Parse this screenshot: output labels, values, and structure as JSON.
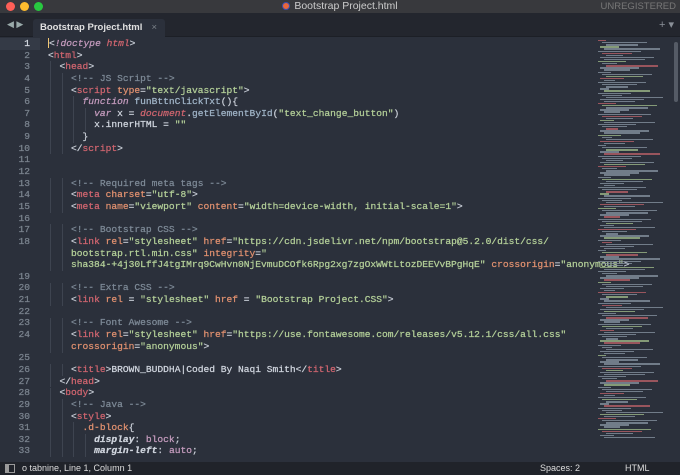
{
  "window": {
    "title": "Bootstrap Project.html",
    "unregistered": "UNREGISTERED"
  },
  "tabs": [
    {
      "label": "Bootstrap Project.html",
      "close": "×"
    }
  ],
  "tabbar": {
    "nav": "◀ ▶",
    "actions": "+ ▾"
  },
  "status": {
    "left": "o tabnine, Line 1, Column 1",
    "spaces": "Spaces: 2",
    "syntax": "HTML"
  },
  "colors": {
    "background": "#2b303b",
    "tag": "#bf616a",
    "attr": "#d08770",
    "string": "#a3be8c",
    "comment": "#65737e"
  },
  "lines": [
    {
      "n": "1",
      "i": 0,
      "rows": [
        [
          [
            "punct",
            "<"
          ],
          [
            "kw",
            "!doctype"
          ],
          [
            "plain",
            " "
          ],
          [
            "var",
            "html"
          ],
          [
            "punct",
            ">"
          ]
        ]
      ]
    },
    {
      "n": "2",
      "i": 0,
      "rows": [
        [
          [
            "punct",
            "<"
          ],
          [
            "tag",
            "html"
          ],
          [
            "punct",
            ">"
          ]
        ]
      ]
    },
    {
      "n": "3",
      "i": 2,
      "rows": [
        [
          [
            "punct",
            "<"
          ],
          [
            "tag",
            "head"
          ],
          [
            "punct",
            ">"
          ]
        ]
      ]
    },
    {
      "n": "4",
      "i": 4,
      "rows": [
        [
          [
            "com",
            "<!-- JS Script -->"
          ]
        ]
      ]
    },
    {
      "n": "5",
      "i": 4,
      "rows": [
        [
          [
            "punct",
            "<"
          ],
          [
            "tag",
            "script"
          ],
          [
            "plain",
            " "
          ],
          [
            "attr",
            "type"
          ],
          [
            "punct",
            "="
          ],
          [
            "str",
            "\"text/javascript\""
          ],
          [
            "punct",
            ">"
          ]
        ]
      ]
    },
    {
      "n": "6",
      "i": 6,
      "rows": [
        [
          [
            "kw",
            "function"
          ],
          [
            "plain",
            " "
          ],
          [
            "fn",
            "funBttnClickTxt"
          ],
          [
            "punct",
            "(){"
          ]
        ]
      ]
    },
    {
      "n": "7",
      "i": 8,
      "rows": [
        [
          [
            "kw",
            "var"
          ],
          [
            "plain",
            " x = "
          ],
          [
            "var",
            "document"
          ],
          [
            "plain",
            "."
          ],
          [
            "fn",
            "getElementById"
          ],
          [
            "punct",
            "("
          ],
          [
            "str",
            "\"text_change_button\""
          ],
          [
            "punct",
            ")"
          ]
        ]
      ]
    },
    {
      "n": "8",
      "i": 8,
      "rows": [
        [
          [
            "plain",
            "x.innerHTML = "
          ],
          [
            "str",
            "\"\""
          ]
        ]
      ]
    },
    {
      "n": "9",
      "i": 6,
      "rows": [
        [
          [
            "punct",
            "}"
          ]
        ]
      ]
    },
    {
      "n": "10",
      "i": 4,
      "rows": [
        [
          [
            "punct",
            "</"
          ],
          [
            "tag",
            "script"
          ],
          [
            "punct",
            ">"
          ]
        ]
      ]
    },
    {
      "n": "11",
      "i": 0,
      "rows": [
        []
      ]
    },
    {
      "n": "12",
      "i": 0,
      "rows": [
        []
      ]
    },
    {
      "n": "13",
      "i": 4,
      "rows": [
        [
          [
            "com",
            "<!-- Required meta tags -->"
          ]
        ]
      ]
    },
    {
      "n": "14",
      "i": 4,
      "rows": [
        [
          [
            "punct",
            "<"
          ],
          [
            "tag",
            "meta"
          ],
          [
            "plain",
            " "
          ],
          [
            "attr",
            "charset"
          ],
          [
            "punct",
            "="
          ],
          [
            "str",
            "\"utf-8\""
          ],
          [
            "punct",
            ">"
          ]
        ]
      ]
    },
    {
      "n": "15",
      "i": 4,
      "rows": [
        [
          [
            "punct",
            "<"
          ],
          [
            "tag",
            "meta"
          ],
          [
            "plain",
            " "
          ],
          [
            "attr",
            "name"
          ],
          [
            "punct",
            "="
          ],
          [
            "str",
            "\"viewport\""
          ],
          [
            "plain",
            " "
          ],
          [
            "attr",
            "content"
          ],
          [
            "punct",
            "="
          ],
          [
            "str",
            "\"width=device-width, initial-scale=1\""
          ],
          [
            "punct",
            ">"
          ]
        ]
      ]
    },
    {
      "n": "16",
      "i": 0,
      "rows": [
        []
      ]
    },
    {
      "n": "17",
      "i": 4,
      "rows": [
        [
          [
            "com",
            "<!-- Bootstrap CSS -->"
          ]
        ]
      ]
    },
    {
      "n": "18",
      "i": 4,
      "rows": [
        [
          [
            "punct",
            "<"
          ],
          [
            "tag",
            "link"
          ],
          [
            "plain",
            " "
          ],
          [
            "attr",
            "rel"
          ],
          [
            "punct",
            "="
          ],
          [
            "str",
            "\"stylesheet\""
          ],
          [
            "plain",
            " "
          ],
          [
            "attr",
            "href"
          ],
          [
            "punct",
            "="
          ],
          [
            "str",
            "\"https://cdn.jsdelivr.net/npm/bootstrap@5.2.0/dist/css/"
          ]
        ],
        [
          [
            "str",
            "bootstrap.rtl.min.css\""
          ],
          [
            "plain",
            " "
          ],
          [
            "attr",
            "integrity"
          ],
          [
            "punct",
            "="
          ],
          [
            "str",
            "\""
          ]
        ],
        [
          [
            "str",
            "sha384-+4j30LffJ4tgIMrq9CwHvn0NjEvmuDCOfk6Rpg2xg7zgOxWWtLtozDEEVvBPgHqE\""
          ],
          [
            "plain",
            " "
          ],
          [
            "attr",
            "crossorigin"
          ],
          [
            "punct",
            "="
          ],
          [
            "str",
            "\"anonymous\""
          ],
          [
            "punct",
            ">"
          ]
        ]
      ]
    },
    {
      "n": "19",
      "i": 0,
      "rows": [
        []
      ]
    },
    {
      "n": "20",
      "i": 4,
      "rows": [
        [
          [
            "com",
            "<!-- Extra CSS -->"
          ]
        ]
      ]
    },
    {
      "n": "21",
      "i": 4,
      "rows": [
        [
          [
            "punct",
            "<"
          ],
          [
            "tag",
            "link"
          ],
          [
            "plain",
            " "
          ],
          [
            "attr",
            "rel"
          ],
          [
            "plain",
            " = "
          ],
          [
            "str",
            "\"stylesheet\""
          ],
          [
            "plain",
            " "
          ],
          [
            "attr",
            "href"
          ],
          [
            "plain",
            " = "
          ],
          [
            "str",
            "\"Bootstrap Project.CSS\""
          ],
          [
            "punct",
            ">"
          ]
        ]
      ]
    },
    {
      "n": "22",
      "i": 0,
      "rows": [
        []
      ]
    },
    {
      "n": "23",
      "i": 4,
      "rows": [
        [
          [
            "com",
            "<!-- Font Awesome -->"
          ]
        ]
      ]
    },
    {
      "n": "24",
      "i": 4,
      "rows": [
        [
          [
            "punct",
            "<"
          ],
          [
            "tag",
            "link"
          ],
          [
            "plain",
            " "
          ],
          [
            "attr",
            "rel"
          ],
          [
            "punct",
            "="
          ],
          [
            "str",
            "\"stylesheet\""
          ],
          [
            "plain",
            " "
          ],
          [
            "attr",
            "href"
          ],
          [
            "punct",
            "="
          ],
          [
            "str",
            "\"https://use.fontawesome.com/releases/v5.12.1/css/all.css\""
          ]
        ],
        [
          [
            "attr",
            "crossorigin"
          ],
          [
            "punct",
            "="
          ],
          [
            "str",
            "\"anonymous\""
          ],
          [
            "punct",
            ">"
          ]
        ]
      ]
    },
    {
      "n": "25",
      "i": 0,
      "rows": [
        []
      ]
    },
    {
      "n": "26",
      "i": 4,
      "rows": [
        [
          [
            "punct",
            "<"
          ],
          [
            "tag",
            "title"
          ],
          [
            "punct",
            ">"
          ],
          [
            "plain",
            "BROWN_BUDDHA|Coded By Naqi Smith"
          ],
          [
            "punct",
            "</"
          ],
          [
            "tag",
            "title"
          ],
          [
            "punct",
            ">"
          ]
        ]
      ]
    },
    {
      "n": "27",
      "i": 2,
      "rows": [
        [
          [
            "punct",
            "</"
          ],
          [
            "tag",
            "head"
          ],
          [
            "punct",
            ">"
          ]
        ]
      ]
    },
    {
      "n": "28",
      "i": 2,
      "rows": [
        [
          [
            "punct",
            "<"
          ],
          [
            "tag",
            "body"
          ],
          [
            "punct",
            ">"
          ]
        ]
      ]
    },
    {
      "n": "29",
      "i": 4,
      "rows": [
        [
          [
            "com",
            "<!-- Java -->"
          ]
        ]
      ]
    },
    {
      "n": "30",
      "i": 4,
      "rows": [
        [
          [
            "punct",
            "<"
          ],
          [
            "tag",
            "style"
          ],
          [
            "punct",
            ">"
          ]
        ]
      ]
    },
    {
      "n": "31",
      "i": 6,
      "rows": [
        [
          [
            "sel",
            ".d-block"
          ],
          [
            "punct",
            "{"
          ]
        ]
      ]
    },
    {
      "n": "32",
      "i": 8,
      "rows": [
        [
          [
            "prop",
            "display"
          ],
          [
            "punct",
            ": "
          ],
          [
            "val",
            "block"
          ],
          [
            "punct",
            ";"
          ]
        ]
      ]
    },
    {
      "n": "33",
      "i": 8,
      "rows": [
        [
          [
            "prop",
            "margin-left"
          ],
          [
            "punct",
            ": "
          ],
          [
            "val",
            "auto"
          ],
          [
            "punct",
            ";"
          ]
        ]
      ]
    }
  ]
}
